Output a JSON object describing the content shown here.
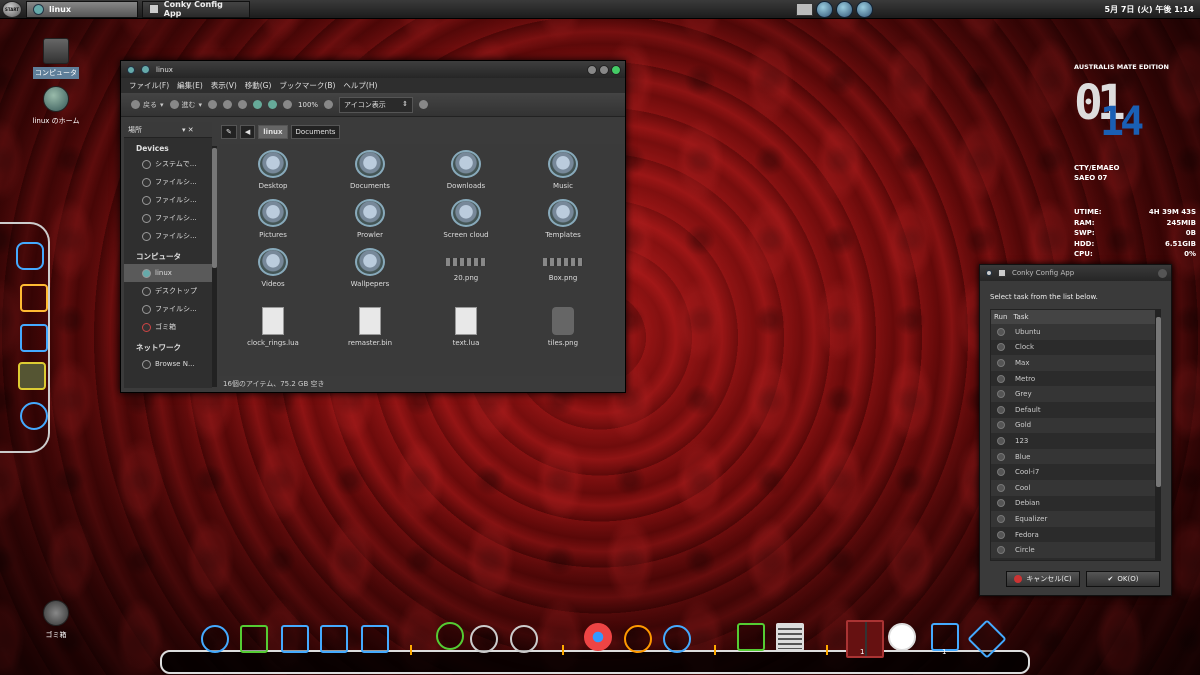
{
  "top_panel": {
    "start_label": "START",
    "tasks": [
      {
        "label": "linux",
        "active": true
      },
      {
        "label": "Conky Config App",
        "active": false
      }
    ],
    "clock": "5月 7日 (火) 午後 1:14"
  },
  "desktop": {
    "icons": [
      {
        "label": "コンピュータ",
        "selected": true
      },
      {
        "label": "linux のホーム",
        "selected": false
      },
      {
        "label": "ゴミ箱",
        "selected": false
      }
    ]
  },
  "file_manager": {
    "title": "linux",
    "menu": [
      "ファイル(F)",
      "編集(E)",
      "表示(V)",
      "移動(G)",
      "ブックマーク(B)",
      "ヘルプ(H)"
    ],
    "toolbar": {
      "back": "戻る",
      "forward": "進む",
      "zoom": "100%",
      "view_mode": "アイコン表示"
    },
    "sidebar": {
      "header": "場所",
      "sections": [
        {
          "title": "Devices",
          "items": [
            "システムで...",
            "ファイルシ...",
            "ファイルシ...",
            "ファイルシ...",
            "ファイルシ..."
          ]
        },
        {
          "title": "コンピュータ",
          "items": [
            "linux",
            "デスクトップ",
            "ファイルシ...",
            "ゴミ箱"
          ]
        },
        {
          "title": "ネットワーク",
          "items": [
            "Browse N..."
          ]
        }
      ],
      "selected": "linux"
    },
    "path": [
      "linux",
      "Documents"
    ],
    "items": [
      {
        "name": "Desktop",
        "type": "folder"
      },
      {
        "name": "Documents",
        "type": "folder"
      },
      {
        "name": "Downloads",
        "type": "folder"
      },
      {
        "name": "Music",
        "type": "folder"
      },
      {
        "name": "Pictures",
        "type": "folder"
      },
      {
        "name": "Prowler",
        "type": "folder"
      },
      {
        "name": "Screen cloud",
        "type": "folder"
      },
      {
        "name": "Templates",
        "type": "folder"
      },
      {
        "name": "Videos",
        "type": "folder"
      },
      {
        "name": "Wallpepers",
        "type": "folder"
      },
      {
        "name": "20.png",
        "type": "image"
      },
      {
        "name": "Box.png",
        "type": "image"
      },
      {
        "name": "clock_rings.lua",
        "type": "file"
      },
      {
        "name": "remaster.bin",
        "type": "file"
      },
      {
        "name": "text.lua",
        "type": "file"
      },
      {
        "name": "tiles.png",
        "type": "puzzle"
      }
    ],
    "status": "16個のアイテム、75.2 GB 空き"
  },
  "conky": {
    "edition": "AUSTRALIS MATE EDITION",
    "time_hour": "01",
    "time_min": "14",
    "date_line1": "CTY/EMAEO",
    "date_line2": "SAEO 07",
    "stats": [
      {
        "label": "UTIME:",
        "value": "4H 39M 43S"
      },
      {
        "label": "RAM:",
        "value": "245MIB"
      },
      {
        "label": "SWP:",
        "value": "0B"
      },
      {
        "label": "HDD:",
        "value": "6.51GIB"
      },
      {
        "label": "CPU:",
        "value": "0%"
      }
    ]
  },
  "conky_dialog": {
    "title": "Conky Config App",
    "prompt": "Select task from the list below.",
    "columns": [
      "Run",
      "Task"
    ],
    "tasks": [
      "Ubuntu",
      "Clock",
      "Max",
      "Metro",
      "Grey",
      "Default",
      "Gold",
      "123",
      "Blue",
      "Cool-i7",
      "Cool",
      "Debian",
      "Equalizer",
      "Fedora",
      "Circle"
    ],
    "cancel": "キャンセル(C)",
    "ok": "OK(O)"
  },
  "dock": {
    "workspace_count": "1",
    "trash_count": "1"
  }
}
